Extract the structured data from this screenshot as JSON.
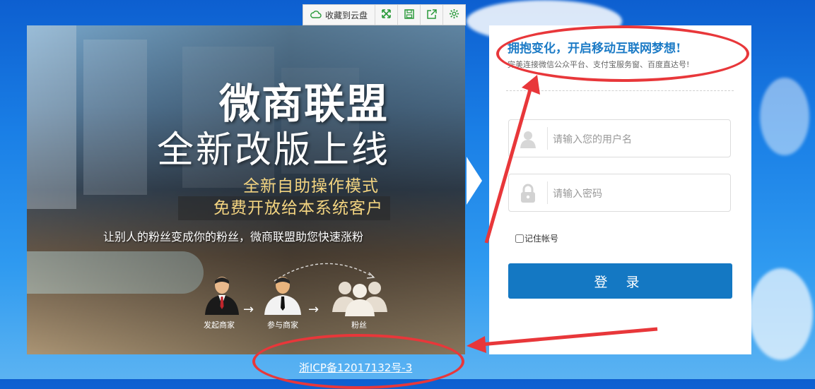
{
  "toolbar": {
    "save_label": "收藏到云盘",
    "icons": [
      "cloud-icon",
      "fullscreen-icon",
      "save-icon",
      "share-icon",
      "settings-icon"
    ]
  },
  "banner": {
    "title": "微商联盟",
    "subtitle": "全新改版上线",
    "feature1": "全新自助操作模式",
    "feature2": "免费开放给本系统客户",
    "tagline": "让别人的粉丝变成你的粉丝，微商联盟助您快速涨粉",
    "flow": [
      "发起商家",
      "参与商家",
      "粉丝"
    ]
  },
  "login": {
    "slogan": "拥抱变化，开启移动互联网梦想!",
    "subslogan": "完美连接微信公众平台、支付宝服务窗、百度直达号!",
    "username_placeholder": "请输入您的用户名",
    "password_placeholder": "请输入密码",
    "remember_label": "记住帐号",
    "submit_label": "登 录"
  },
  "footer": {
    "icp": "浙ICP备12017132号-3"
  },
  "colors": {
    "accent": "#1478c3",
    "slogan": "#1c7bc6",
    "annotation": "#e8373a",
    "banner_highlight": "#f3d480"
  }
}
